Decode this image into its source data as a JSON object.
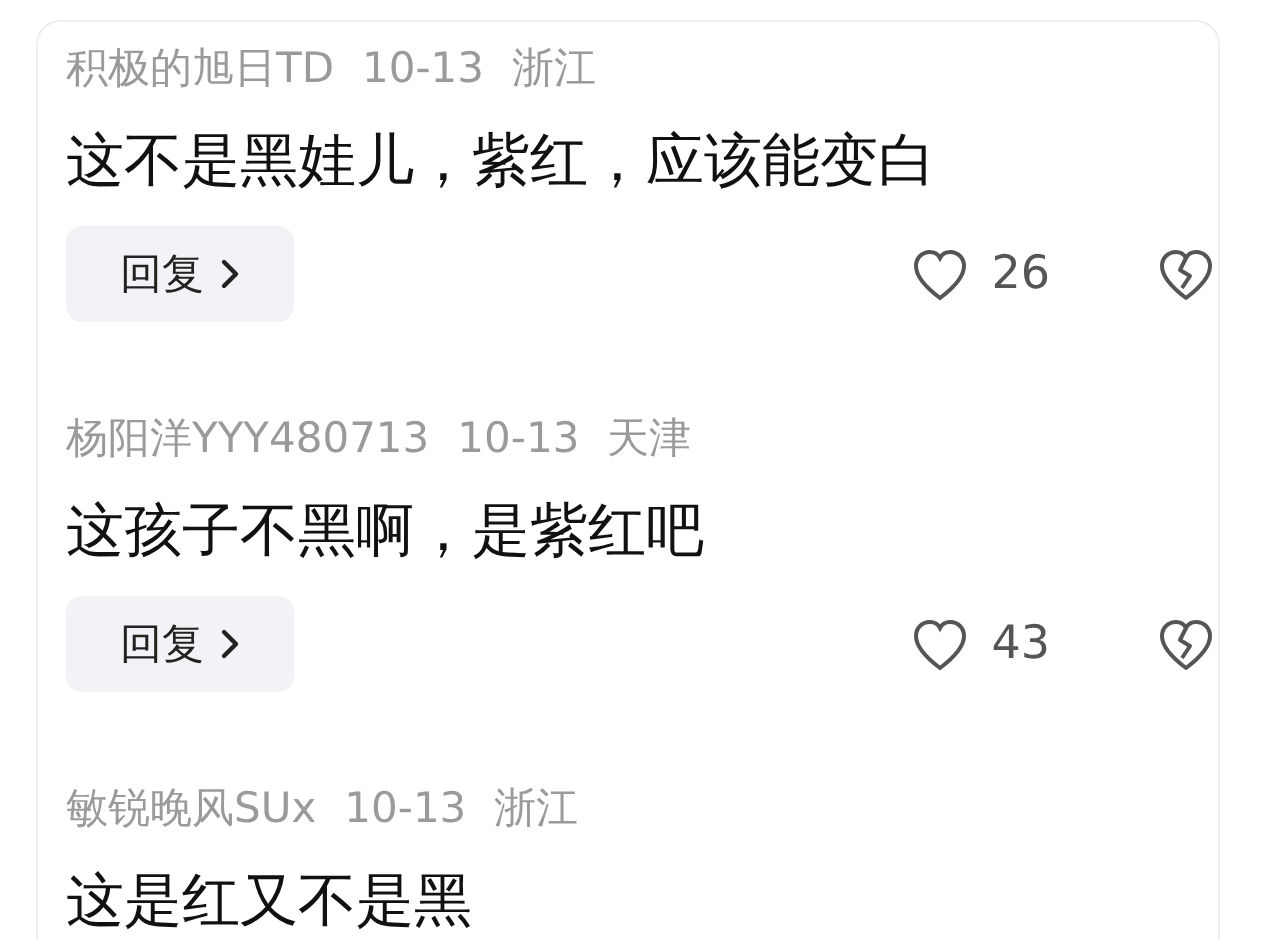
{
  "comments": [
    {
      "author": "积极的旭日TD",
      "date": "10-13",
      "location": "浙江",
      "text": "这不是黑娃儿，紫红，应该能变白",
      "reply_button": "回复",
      "likes": "26"
    },
    {
      "author": "杨阳洋YYY480713",
      "date": "10-13",
      "location": "天津",
      "text": "这孩子不黑啊，是紫红吧",
      "reply_button": "回复",
      "likes": "43"
    },
    {
      "author": "敏锐晚风SUx",
      "date": "10-13",
      "location": "浙江",
      "text": "这是红又不是黑"
    }
  ]
}
